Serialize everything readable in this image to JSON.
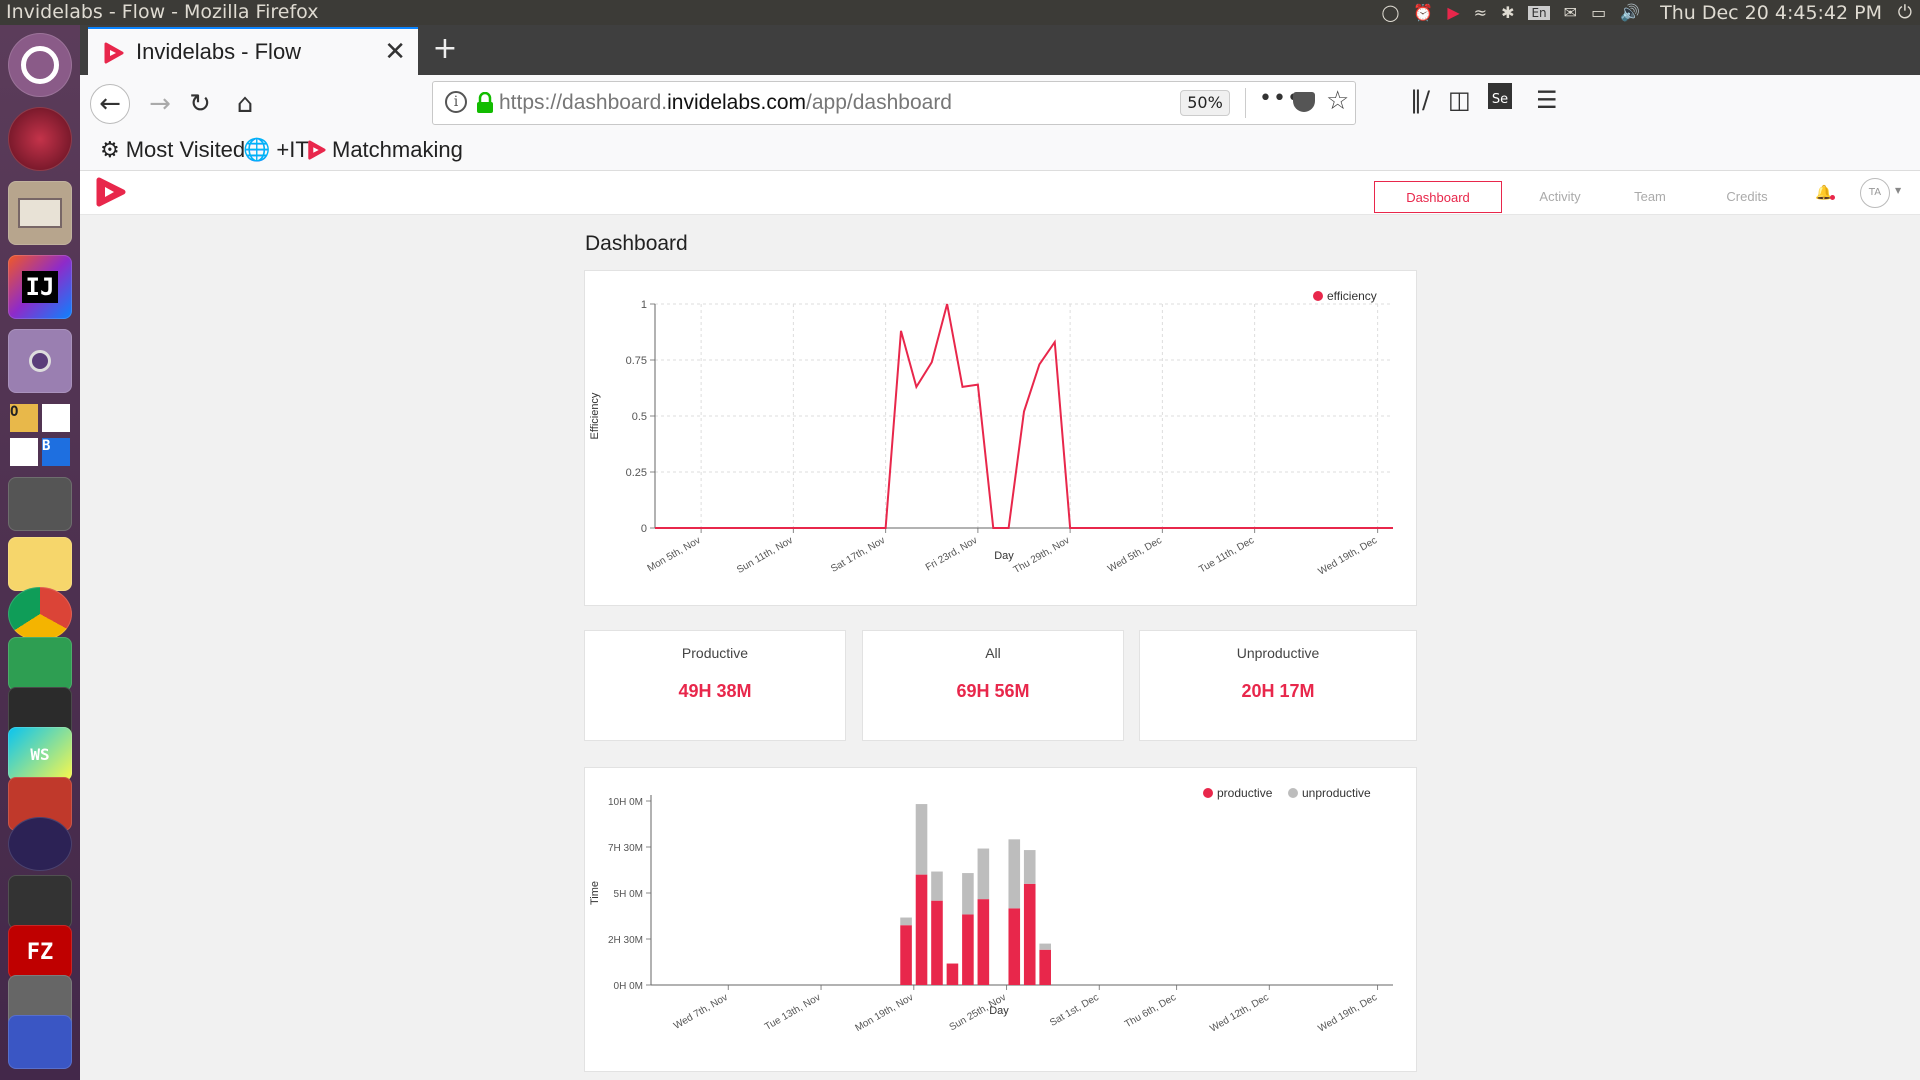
{
  "os": {
    "window_title": "Invidelabs - Flow - Mozilla Firefox",
    "keyboard_layout": "En",
    "clock": "Thu Dec 20  4:45:42 PM"
  },
  "browser": {
    "tab_title": "Invidelabs - Flow",
    "url_prefix": "https://dashboard.",
    "url_domain": "invidelabs.com",
    "url_path": "/app/dashboard",
    "zoom": "50%",
    "bookmarks": [
      "Most Visited",
      "+IT",
      "Matchmaking"
    ]
  },
  "app": {
    "accent": "#e8274b",
    "nav": [
      "Dashboard",
      "Activity",
      "Team",
      "Credits"
    ],
    "avatar": "TA",
    "page_title": "Dashboard",
    "stats": [
      {
        "label": "Productive",
        "value": "49H 38M"
      },
      {
        "label": "All",
        "value": "69H 56M"
      },
      {
        "label": "Unproductive",
        "value": "20H 17M"
      }
    ]
  },
  "chart_data": [
    {
      "type": "line",
      "title": "",
      "xlabel": "Day",
      "ylabel": "Efficiency",
      "ylim": [
        0,
        1
      ],
      "yticks": [
        "0",
        "0.25",
        "0.5",
        "0.75",
        "1"
      ],
      "x_tick_labels": [
        "Mon 5th, Nov",
        "Sun 11th, Nov",
        "Sat 17th, Nov",
        "Fri 23rd, Nov",
        "Thu 29th, Nov",
        "Wed 5th, Dec",
        "Tue 11th, Dec",
        "Wed 19th, Dec"
      ],
      "x_tick_days": [
        3,
        9,
        15,
        21,
        27,
        33,
        39,
        47
      ],
      "x_days": [
        0,
        1,
        2,
        3,
        4,
        5,
        6,
        7,
        8,
        9,
        10,
        11,
        12,
        13,
        14,
        15,
        16,
        17,
        18,
        19,
        20,
        21,
        22,
        23,
        24,
        25,
        26,
        27,
        28,
        29,
        30,
        31,
        32,
        33,
        34,
        35,
        36,
        37,
        38,
        39,
        40,
        41,
        42,
        43,
        44,
        45,
        46,
        47,
        48
      ],
      "series": [
        {
          "name": "efficiency",
          "color": "#e8274b",
          "values": [
            0,
            0,
            0,
            0,
            0,
            0,
            0,
            0,
            0,
            0,
            0,
            0,
            0,
            0,
            0,
            0,
            0.88,
            0.63,
            0.74,
            1.0,
            0.63,
            0.64,
            0,
            0,
            0.52,
            0.73,
            0.83,
            0,
            0,
            0,
            0,
            0,
            0,
            0,
            0,
            0,
            0,
            0,
            0,
            0,
            0,
            0,
            0,
            0,
            0,
            0,
            0,
            0,
            0
          ]
        }
      ],
      "legend": "top-right",
      "grid": true
    },
    {
      "type": "bar",
      "stacked": true,
      "title": "",
      "xlabel": "Day",
      "ylabel": "Time",
      "ylim": [
        0,
        600
      ],
      "yticks": [
        "0H 0M",
        "2H 30M",
        "5H 0M",
        "7H 30M",
        "10H 0M"
      ],
      "x_tick_labels": [
        "Wed 7th, Nov",
        "Tue 13th, Nov",
        "Mon 19th, Nov",
        "Sun 25th, Nov",
        "Sat 1st, Dec",
        "Thu 6th, Dec",
        "Wed 12th, Dec",
        "Wed 19th, Dec"
      ],
      "x_tick_days": [
        5,
        11,
        17,
        23,
        29,
        34,
        40,
        47
      ],
      "bar_days": [
        16,
        17,
        18,
        19,
        20,
        21,
        23,
        24,
        25
      ],
      "series": [
        {
          "name": "productive",
          "color": "#e8274b",
          "values": [
            195,
            360,
            275,
            70,
            230,
            280,
            250,
            330,
            115
          ]
        },
        {
          "name": "unproductive",
          "color": "#bdbdbd",
          "values": [
            25,
            230,
            95,
            0,
            135,
            165,
            225,
            110,
            20
          ]
        }
      ],
      "legend": "top-right",
      "grid": false
    }
  ]
}
